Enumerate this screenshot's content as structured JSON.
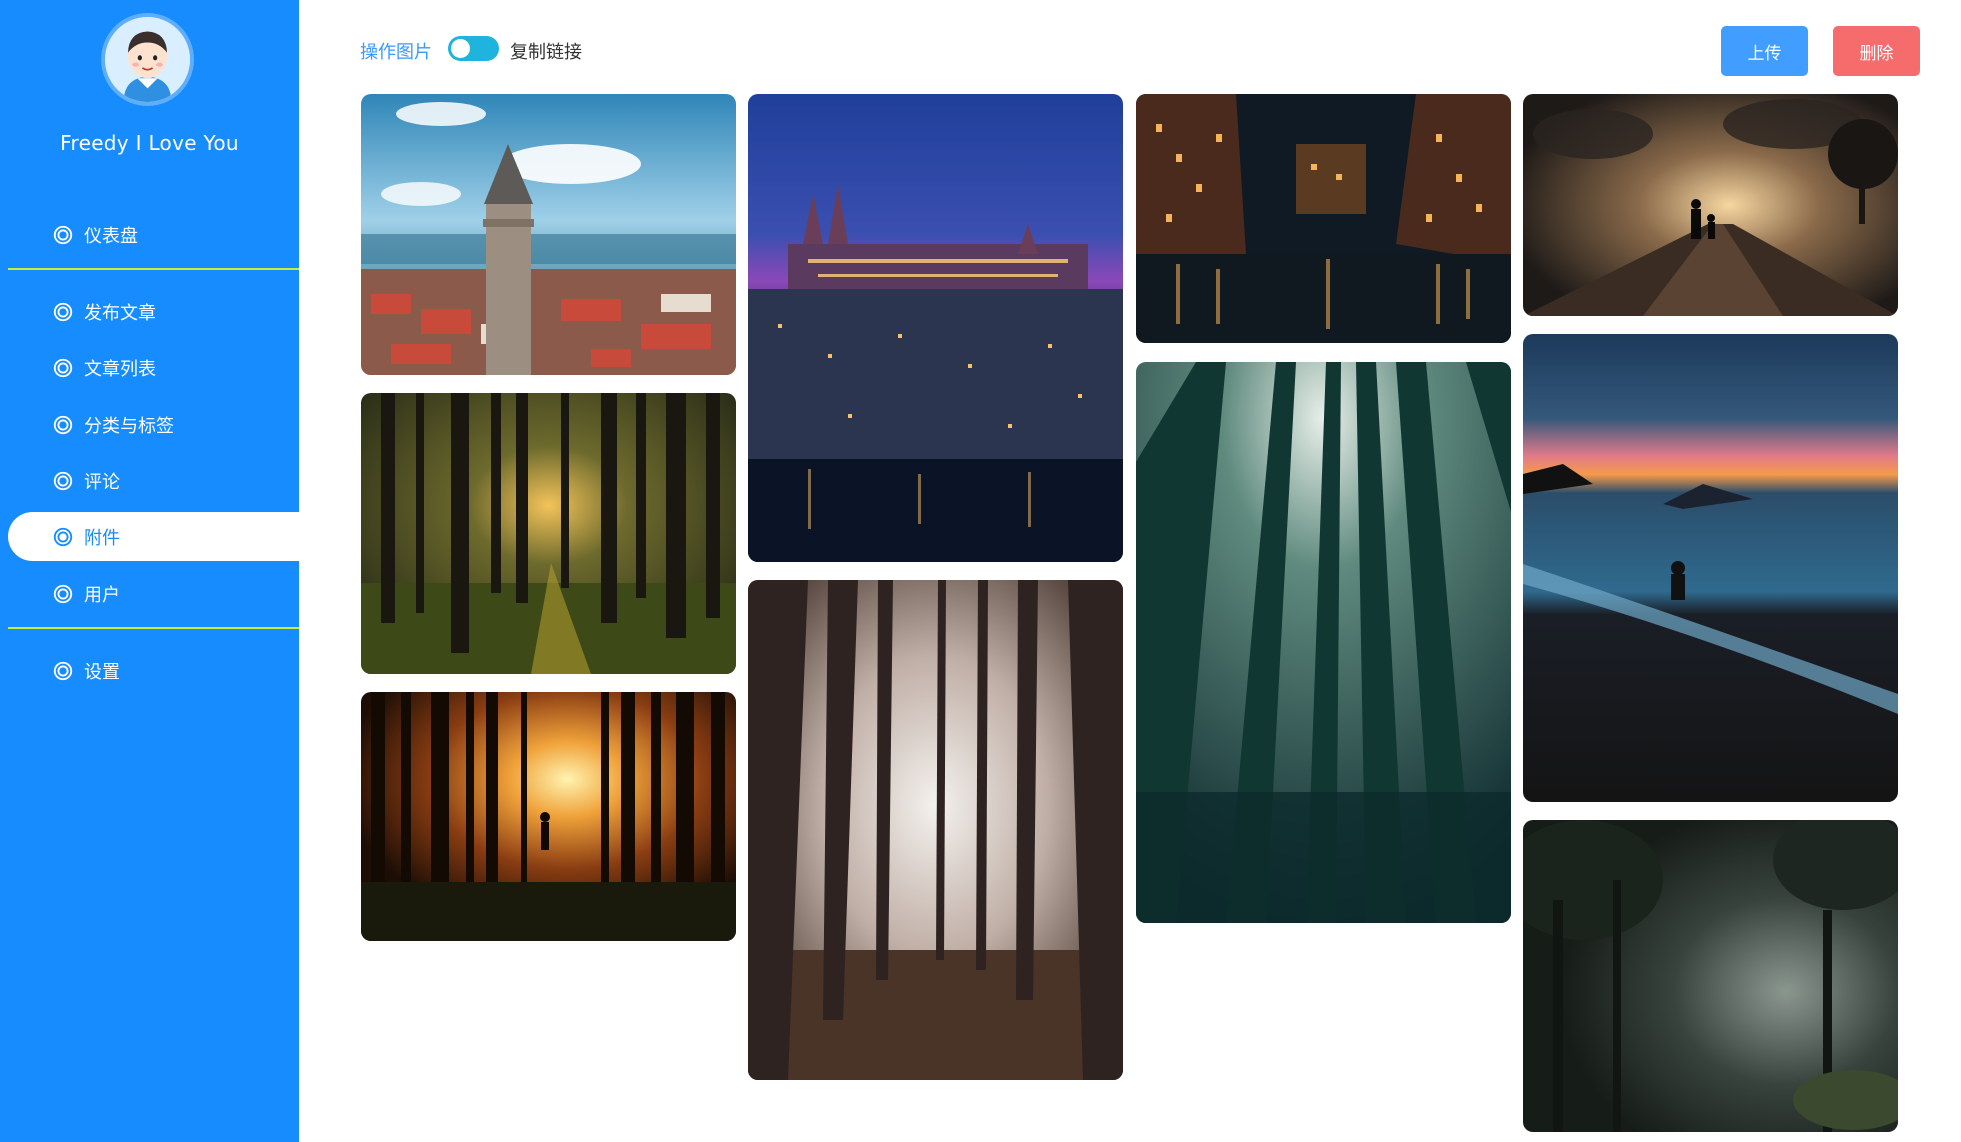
{
  "sidebar": {
    "username": "Freedy I Love You",
    "items": [
      {
        "label": "仪表盘",
        "icon": "circle-icon"
      },
      {
        "label": "发布文章",
        "icon": "circle-icon"
      },
      {
        "label": "文章列表",
        "icon": "circle-icon"
      },
      {
        "label": "分类与标签",
        "icon": "circle-icon"
      },
      {
        "label": "评论",
        "icon": "circle-icon"
      },
      {
        "label": "附件",
        "icon": "circle-icon",
        "active": true
      },
      {
        "label": "用户",
        "icon": "circle-icon"
      },
      {
        "label": "设置",
        "icon": "circle-icon"
      }
    ]
  },
  "toolbar": {
    "operate_label": "操作图片",
    "copy_label": "复制链接",
    "toggle_on": false,
    "upload_label": "上传",
    "delete_label": "删除"
  },
  "colors": {
    "sidebar_bg": "#168cff",
    "divider": "#c7ef3a",
    "toggle": "#1eb4dd",
    "upload": "#419dff",
    "delete": "#f66b6b"
  },
  "gallery": {
    "photos": [
      {
        "subject": "city-tower-aerial"
      },
      {
        "subject": "forest-sunlight"
      },
      {
        "subject": "forest-silhouette-sunset"
      },
      {
        "subject": "castle-night-city"
      },
      {
        "subject": "misty-forest"
      },
      {
        "subject": "canal-night-buildings"
      },
      {
        "subject": "tall-trees-looking-up"
      },
      {
        "subject": "railway-sunset-silhouette"
      },
      {
        "subject": "beach-sunset-person"
      },
      {
        "subject": "dark-jungle"
      }
    ]
  }
}
